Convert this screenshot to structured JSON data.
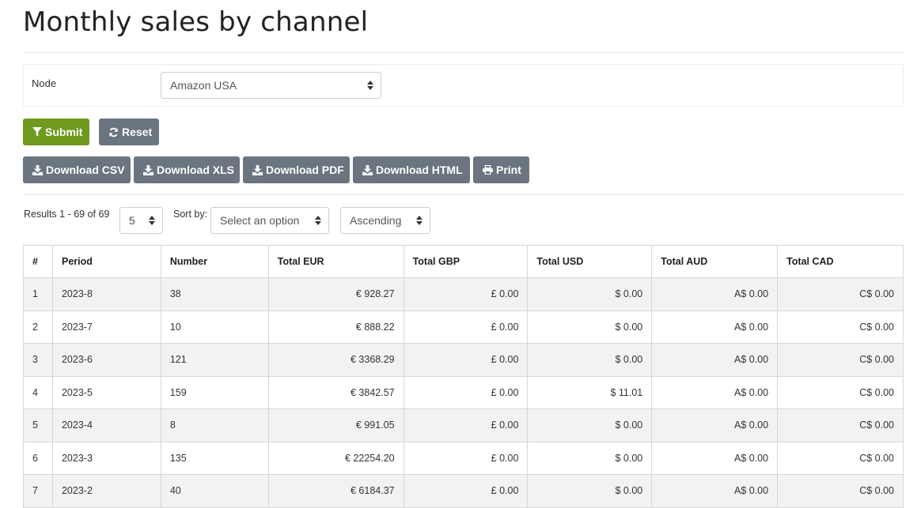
{
  "page": {
    "title": "Monthly sales by channel"
  },
  "filter": {
    "node_label": "Node",
    "node_value": "Amazon USA"
  },
  "actions": {
    "submit_label": "Submit",
    "reset_label": "Reset"
  },
  "downloads": {
    "csv_label": "Download CSV",
    "xls_label": "Download XLS",
    "pdf_label": "Download PDF",
    "html_label": "Download HTML",
    "print_label": "Print"
  },
  "results": {
    "summary": "Results 1 - 69 of 69",
    "page_size": "5",
    "sort_label": "Sort by:",
    "sort_value": "Select an option",
    "order_value": "Ascending"
  },
  "table": {
    "columns": [
      "#",
      "Period",
      "Number",
      "Total EUR",
      "Total GBP",
      "Total USD",
      "Total AUD",
      "Total CAD"
    ],
    "rows": [
      [
        "1",
        "2023-8",
        "38",
        "€ 928.27",
        "£ 0.00",
        "$ 0.00",
        "A$ 0.00",
        "C$ 0.00"
      ],
      [
        "2",
        "2023-7",
        "10",
        "€ 888.22",
        "£ 0.00",
        "$ 0.00",
        "A$ 0.00",
        "C$ 0.00"
      ],
      [
        "3",
        "2023-6",
        "121",
        "€ 3368.29",
        "£ 0.00",
        "$ 0.00",
        "A$ 0.00",
        "C$ 0.00"
      ],
      [
        "4",
        "2023-5",
        "159",
        "€ 3842.57",
        "£ 0.00",
        "$ 11.01",
        "A$ 0.00",
        "C$ 0.00"
      ],
      [
        "5",
        "2023-4",
        "8",
        "€ 991.05",
        "£ 0.00",
        "$ 0.00",
        "A$ 0.00",
        "C$ 0.00"
      ],
      [
        "6",
        "2023-3",
        "135",
        "€ 22254.20",
        "£ 0.00",
        "$ 0.00",
        "A$ 0.00",
        "C$ 0.00"
      ],
      [
        "7",
        "2023-2",
        "40",
        "€ 6184.37",
        "£ 0.00",
        "$ 0.00",
        "A$ 0.00",
        "C$ 0.00"
      ]
    ]
  },
  "icons": {
    "submit": "filter-icon",
    "reset": "refresh-icon",
    "download": "download-icon",
    "print": "print-icon"
  },
  "colors": {
    "submit": "#6e9a1e",
    "secondary": "#6b7580"
  }
}
